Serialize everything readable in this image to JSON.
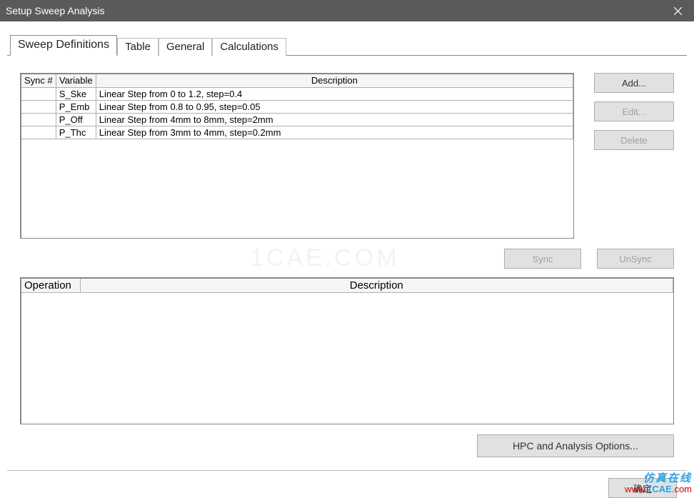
{
  "window": {
    "title": "Setup Sweep Analysis"
  },
  "tabs": {
    "t0": "Sweep Definitions",
    "t1": "Table",
    "t2": "General",
    "t3": "Calculations"
  },
  "grid": {
    "headers": {
      "sync": "Sync #",
      "var": "Variable",
      "desc": "Description"
    },
    "rows": [
      {
        "sync": "",
        "var": "S_Ske",
        "desc": "Linear Step from 0 to 1.2, step=0.4"
      },
      {
        "sync": "",
        "var": "P_Emb",
        "desc": "Linear Step from 0.8 to 0.95, step=0.05"
      },
      {
        "sync": "",
        "var": "P_Off",
        "desc": "Linear Step from 4mm to 8mm, step=2mm"
      },
      {
        "sync": "",
        "var": "P_Thc",
        "desc": "Linear Step from 3mm to 4mm, step=0.2mm"
      }
    ]
  },
  "side": {
    "add": "Add...",
    "edit": "Edit...",
    "delete": "Delete"
  },
  "sync": {
    "sync": "Sync",
    "unsync": "UnSync"
  },
  "ops": {
    "headers": {
      "op": "Operation",
      "desc": "Description"
    }
  },
  "hpc": {
    "label": "HPC and Analysis Options..."
  },
  "footer": {
    "ok": "确定"
  },
  "watermark": {
    "bg": "1CAE.COM",
    "line1": "仿真在线",
    "line2a": "www.",
    "line2b": "1CAE",
    "line2c": ".com"
  }
}
